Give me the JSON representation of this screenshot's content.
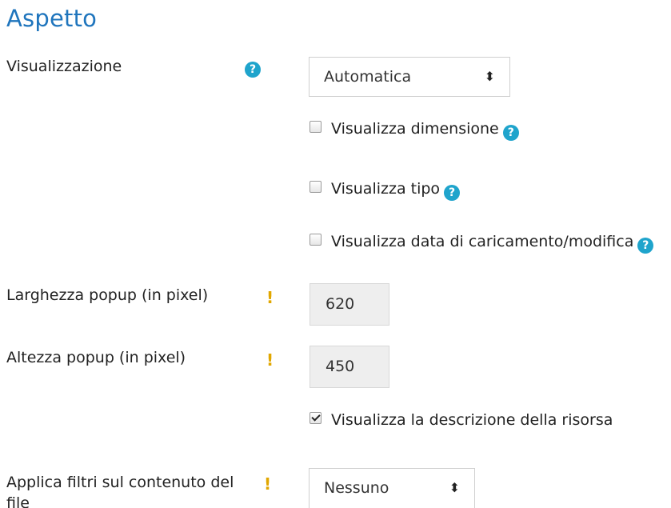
{
  "section": {
    "title": "Aspetto"
  },
  "display": {
    "label": "Visualizzazione",
    "select_value": "Automatica",
    "help_icon": "question-circle-icon"
  },
  "checkboxes": [
    {
      "label": "Visualizza dimensione",
      "checked": false,
      "has_help": true
    },
    {
      "label": "Visualizza tipo",
      "checked": false,
      "has_help": true
    },
    {
      "label": "Visualizza data di caricamento/modifica",
      "checked": false,
      "has_help": true
    }
  ],
  "popup_width": {
    "label": "Larghezza popup (in pixel)",
    "value": "620",
    "icon": "advanced-exclamation-icon"
  },
  "popup_height": {
    "label": "Altezza popup (in pixel)",
    "value": "450",
    "icon": "advanced-exclamation-icon"
  },
  "show_description": {
    "label": "Visualizza la descrizione della risorsa",
    "checked": true
  },
  "filters": {
    "label": "Applica filtri sul contenuto del file",
    "select_value": "Nessuno",
    "icon": "advanced-exclamation-icon"
  },
  "colors": {
    "title": "#1f75bd",
    "help_icon": "#1fa4cc",
    "advanced_icon": "#e1a700",
    "input_bg": "#eeeeee"
  }
}
